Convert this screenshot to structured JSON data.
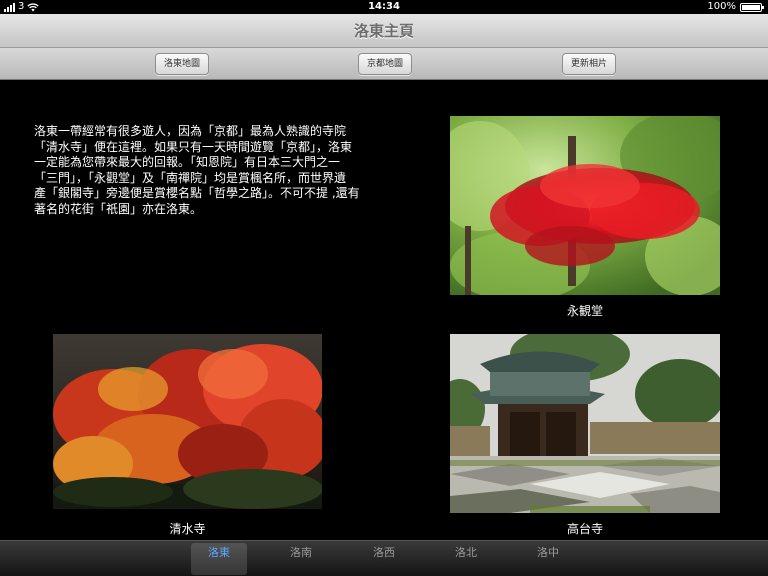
{
  "status_bar": {
    "carrier": "3",
    "time": "14:34",
    "battery": "100%"
  },
  "nav_bar": {
    "title": "洛東主頁"
  },
  "toolbar": {
    "rakuto_map": "洛東地圖",
    "kyoto_map": "京都地圖",
    "refresh_photos": "更新相片"
  },
  "intro_text": "洛東一帶經常有很多遊人，因為「京都」最為人熟識的寺院\n「清水寺」便在這裡。如果只有一天時間遊覽「京都」，洛東\n一定能為您帶來最大的回報。「知恩院」有日本三大門之一\n「三門」，「永觀堂」及「南禪院」均是賞楓名所，而世界遺\n產「銀閣寺」旁邊便是賞櫻名點「哲學之路」。不可不提 ,還有\n著名的花街「祇園」亦在洛東。",
  "photos": {
    "eikando": {
      "caption": "永観堂"
    },
    "kiyomizudera": {
      "caption": "清水寺"
    },
    "kodaiji": {
      "caption": "高台寺"
    }
  },
  "tab_bar": {
    "tabs": [
      {
        "label": "洛東",
        "active": true
      },
      {
        "label": "洛南",
        "active": false
      },
      {
        "label": "洛西",
        "active": false
      },
      {
        "label": "洛北",
        "active": false
      },
      {
        "label": "洛中",
        "active": false
      }
    ]
  },
  "colors": {
    "active_tab": "#5aa9ff",
    "nav_title": "#6d6d6d",
    "background": "#000000"
  }
}
